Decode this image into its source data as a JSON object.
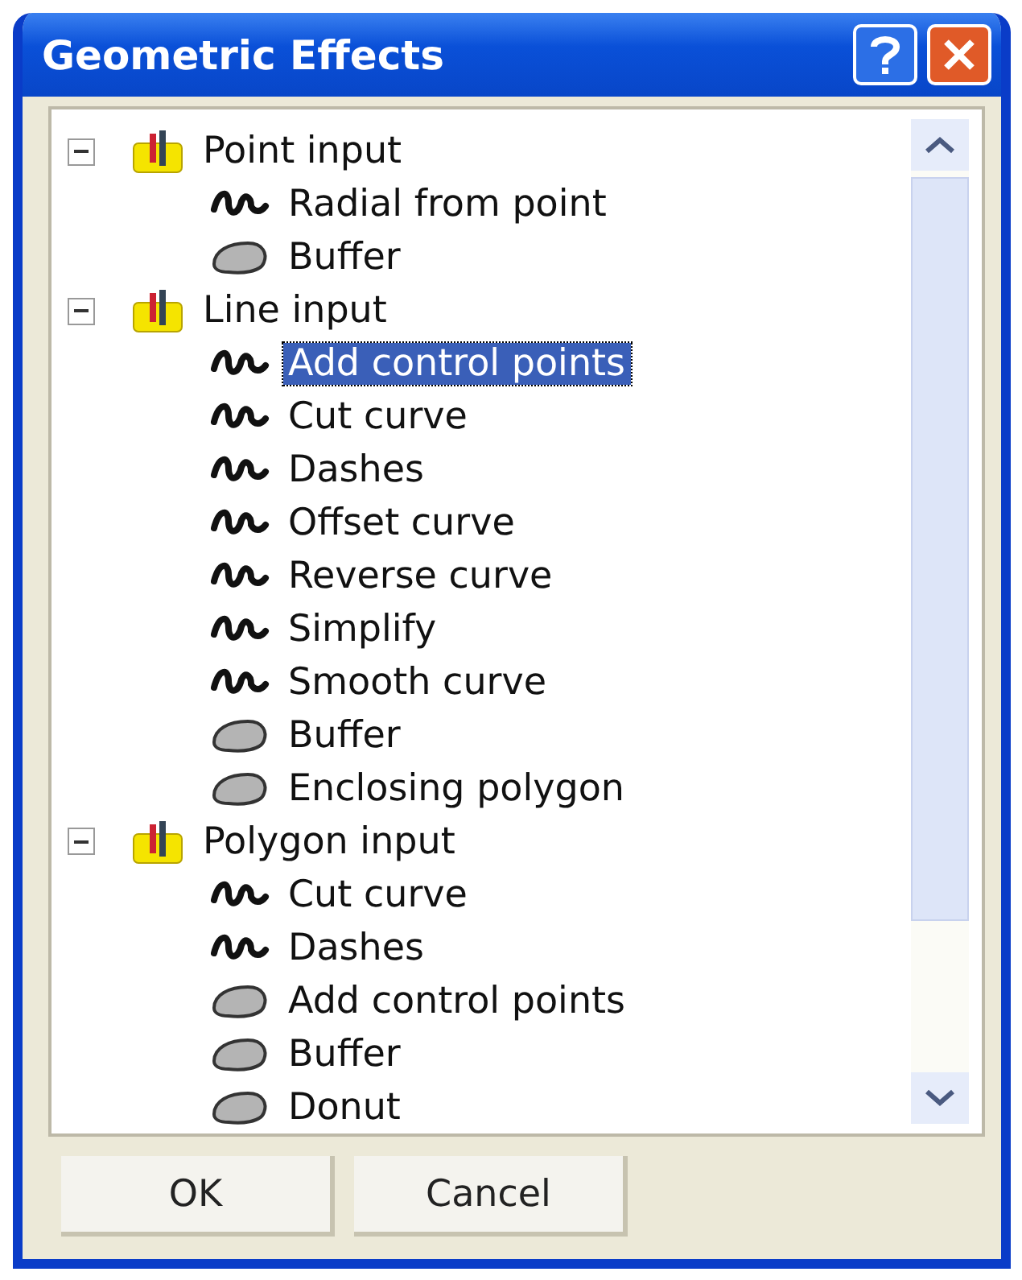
{
  "window": {
    "title": "Geometric Effects"
  },
  "tree": [
    {
      "label": "Point input",
      "expanded": true,
      "children": [
        {
          "label": "Radial from point",
          "kind": "curve",
          "selected": false
        },
        {
          "label": "Buffer",
          "kind": "area",
          "selected": false
        }
      ]
    },
    {
      "label": "Line input",
      "expanded": true,
      "children": [
        {
          "label": "Add control points",
          "kind": "curve",
          "selected": true
        },
        {
          "label": "Cut curve",
          "kind": "curve",
          "selected": false
        },
        {
          "label": "Dashes",
          "kind": "curve",
          "selected": false
        },
        {
          "label": "Offset curve",
          "kind": "curve",
          "selected": false
        },
        {
          "label": "Reverse curve",
          "kind": "curve",
          "selected": false
        },
        {
          "label": "Simplify",
          "kind": "curve",
          "selected": false
        },
        {
          "label": "Smooth curve",
          "kind": "curve",
          "selected": false
        },
        {
          "label": "Buffer",
          "kind": "area",
          "selected": false
        },
        {
          "label": "Enclosing polygon",
          "kind": "area",
          "selected": false
        }
      ]
    },
    {
      "label": "Polygon input",
      "expanded": true,
      "children": [
        {
          "label": "Cut curve",
          "kind": "curve",
          "selected": false
        },
        {
          "label": "Dashes",
          "kind": "curve",
          "selected": false
        },
        {
          "label": "Add control points",
          "kind": "area",
          "selected": false
        },
        {
          "label": "Buffer",
          "kind": "area",
          "selected": false
        },
        {
          "label": "Donut",
          "kind": "area",
          "selected": false
        }
      ]
    }
  ],
  "buttons": [
    "OK",
    "Cancel"
  ]
}
